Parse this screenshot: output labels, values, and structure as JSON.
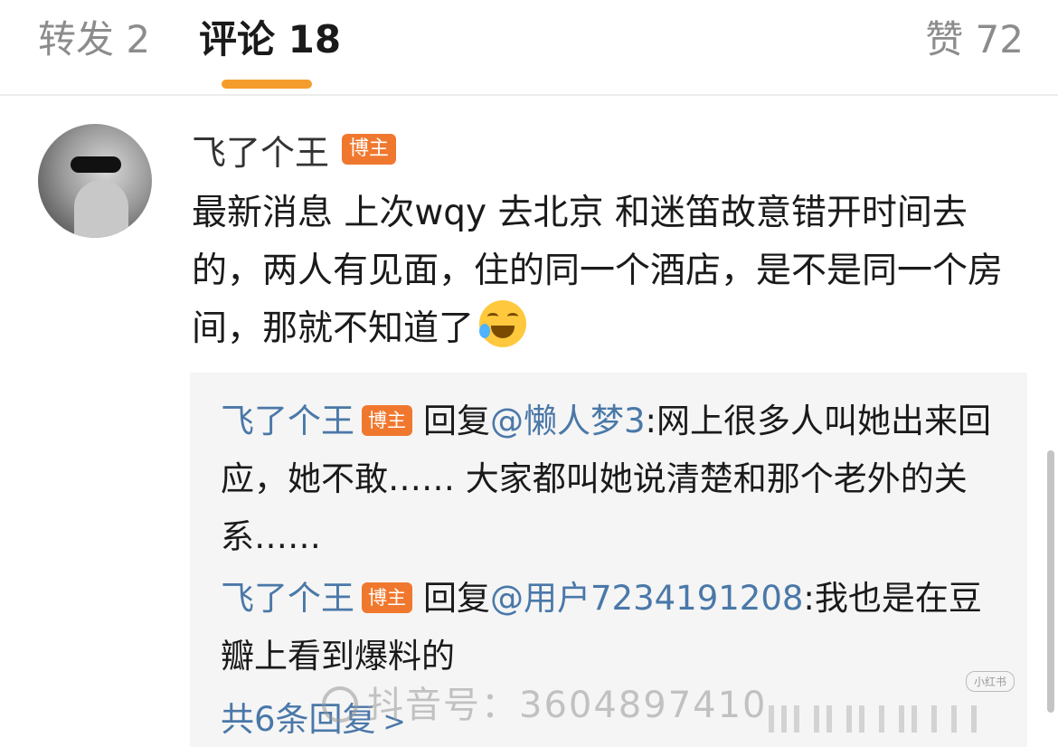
{
  "tabs": {
    "repost": "转发 2",
    "comments": "评论 18",
    "likes": "赞 72"
  },
  "colors": {
    "accent": "#f59d2c",
    "badge": "#f0782e",
    "link": "#4a78a8"
  },
  "comment": {
    "author": "飞了个王",
    "badge": "博主",
    "text": "最新消息 上次wqy 去北京 和迷笛故意错开时间去的，两人有见面，住的同一个酒店，是不是同一个房间，那就不知道了",
    "emoji_icon": "laugh-cry-emoji"
  },
  "replies": [
    {
      "author": "飞了个王",
      "badge": "博主",
      "reply_word": "回复",
      "mention": "@懒人梦3",
      "text": ":网上很多人叫她出来回应，她不敢…… 大家都叫她说清楚和那个老外的关系……"
    },
    {
      "author": "飞了个王",
      "badge": "博主",
      "reply_word": "回复",
      "mention": "@用户7234191208",
      "text": ":我也是在豆瓣上看到爆料的"
    }
  ],
  "more_replies": "共6条回复",
  "watermark": "抖音号：3604897410",
  "small_watermark": "小红书"
}
